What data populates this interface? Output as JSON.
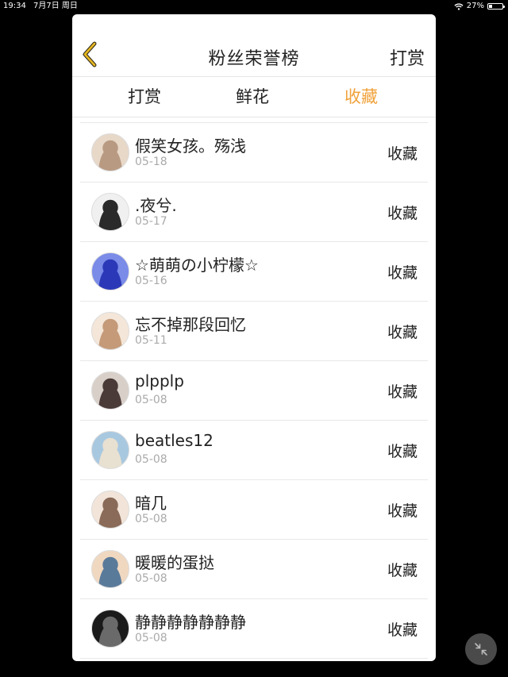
{
  "status_bar": {
    "time": "19:34",
    "date": "7月7日 周日",
    "battery": "27%",
    "battery_level": 0.27
  },
  "header": {
    "title": "粉丝荣誉榜",
    "action_label": "打赏",
    "back_icon": "chevron-left-icon",
    "accent_color": "#f0a23a"
  },
  "tabs": [
    {
      "label": "打赏",
      "active": false
    },
    {
      "label": "鲜花",
      "active": false
    },
    {
      "label": "收藏",
      "active": true
    }
  ],
  "list": [
    {
      "name": "假笑女孩。殇浅",
      "date": "05-18",
      "action": "收藏",
      "avatar_colors": [
        "#e8d8c8",
        "#b89a82"
      ]
    },
    {
      "name": ".夜兮.",
      "date": "05-17",
      "action": "收藏",
      "avatar_colors": [
        "#f0f0f0",
        "#2a2a2a"
      ]
    },
    {
      "name": "☆萌萌の小柠檬☆",
      "date": "05-16",
      "action": "收藏",
      "avatar_colors": [
        "#7a8be8",
        "#2b39b8"
      ]
    },
    {
      "name": "忘不掉那段回忆",
      "date": "05-11",
      "action": "收藏",
      "avatar_colors": [
        "#f4e6d8",
        "#c49a78"
      ]
    },
    {
      "name": "plpplp",
      "date": "05-08",
      "action": "收藏",
      "avatar_colors": [
        "#d8d0c8",
        "#4a3a38"
      ]
    },
    {
      "name": "beatles12",
      "date": "05-08",
      "action": "收藏",
      "avatar_colors": [
        "#a8c8e0",
        "#e8e0d0"
      ]
    },
    {
      "name": "暗几",
      "date": "05-08",
      "action": "收藏",
      "avatar_colors": [
        "#f2e4d8",
        "#8a6a58"
      ]
    },
    {
      "name": "暖暖的蛋挞",
      "date": "05-08",
      "action": "收藏",
      "avatar_colors": [
        "#f0d8c0",
        "#5a7a9a"
      ]
    },
    {
      "name": "静静静静静静静",
      "date": "05-08",
      "action": "收藏",
      "avatar_colors": [
        "#1a1a1a",
        "#6a6a6a"
      ]
    }
  ],
  "float_button_icon": "minimize-arrows-icon"
}
